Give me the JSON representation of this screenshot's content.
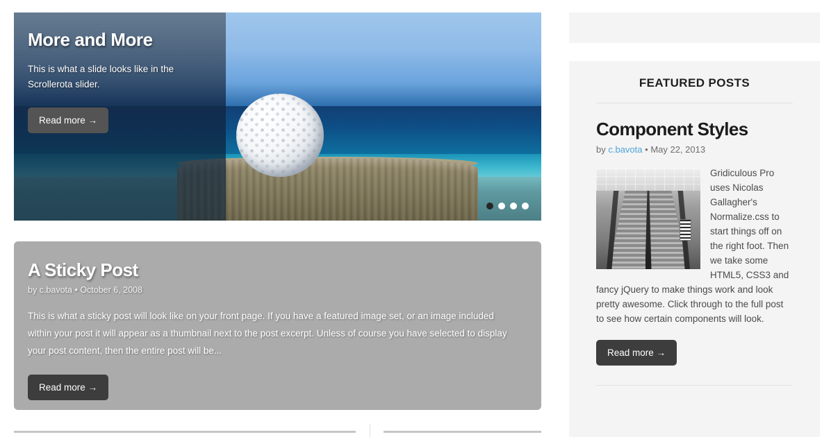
{
  "slider": {
    "title": "More and More",
    "description": "This is what a slide looks like in the Scrollerota slider.",
    "read_more": "Read more →",
    "dots": [
      {
        "name": "slide-1",
        "active": true
      },
      {
        "name": "slide-2",
        "active": false
      },
      {
        "name": "slide-3",
        "active": false
      },
      {
        "name": "slide-4",
        "active": false
      }
    ],
    "image_alt": "golf-ball-on-wooden-post-by-the-ocean"
  },
  "sticky_post": {
    "title": "A Sticky Post",
    "meta_by": "by",
    "author": "c.bavota",
    "separator": "•",
    "date": "October 6, 2008",
    "excerpt": "This is what a sticky post will look like on your front page. If you have a featured image set, or an image included within your post it will appear as a thumbnail next to the post excerpt. Unless of course you have selected to display your post content, then the entire post will be...",
    "read_more": "Read more →"
  },
  "sidebar": {
    "widget_title": "FEATURED POSTS",
    "featured_post": {
      "title": "Component Styles",
      "meta_by": "by",
      "author": "c.bavota",
      "separator": "•",
      "date": "May 22, 2013",
      "body": "Gridiculous Pro uses Nicolas Gallagher's Normalize.css to start things off on the right foot. Then we take some HTML5, CSS3 and fancy jQuery to make things work and look pretty awesome. Click through to the full post to see how certain components will look.",
      "read_more": "Read more →",
      "thumbnail_alt": "black-and-white-escalator-photo"
    }
  },
  "colors": {
    "button_dark": "#3d3d3d",
    "sticky_background": "#ababab",
    "widget_background": "#f4f4f4",
    "link_blue": "#4da3d8",
    "rule_gray": "#c6c6c6"
  }
}
